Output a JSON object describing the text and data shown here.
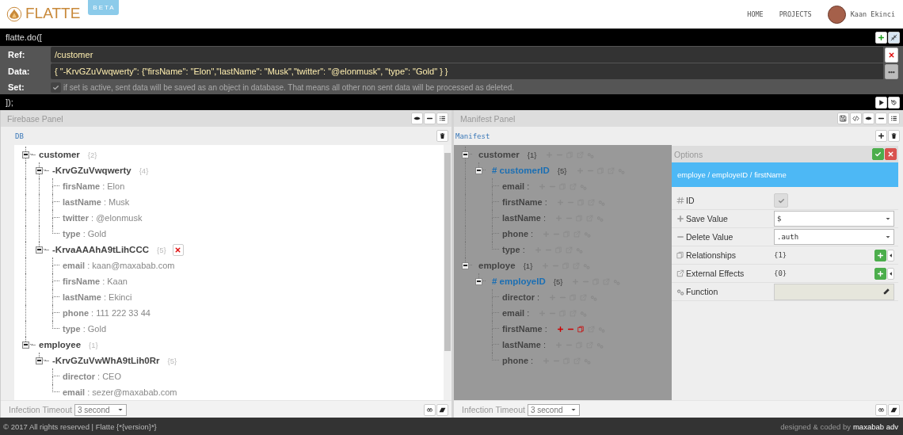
{
  "header": {
    "logo": "FLATTE",
    "badge": "BETA",
    "nav": [
      {
        "label": "HOME"
      },
      {
        "label": "PROJECTS"
      }
    ],
    "user": "Kaan Ekinci"
  },
  "command": {
    "open": "flatte.do([",
    "close": "]);",
    "rows": [
      {
        "kind": "text",
        "label": "Ref:",
        "value": "/customer"
      },
      {
        "kind": "text",
        "label": "Data:",
        "value": "{ \"-KrvGZuVwqwerty\": {\"firsName\": \"Elon\",\"lastName\": \"Musk\",\"twitter\": \"@elonmusk\",  \"type\": \"Gold\" } }"
      },
      {
        "kind": "checkbox",
        "label": "Set:",
        "checked": true,
        "hint": "if set is active, sent data will be saved as an object in database. That means all other non sent data will be processed as deleted."
      }
    ]
  },
  "firebase_panel": {
    "title": "Firebase Panel",
    "root": "DB",
    "timeout_label": "Infection Timeout",
    "timeout": "3 second",
    "tree": [
      {
        "key": "customer",
        "count": "{2}",
        "expanded": true,
        "delete_button": false,
        "children": [
          {
            "key": "-KrvGZuVwqwerty",
            "count": "{4}",
            "expanded": true,
            "delete_button": false,
            "children": [
              {
                "label": "**firsName** : Elon"
              },
              {
                "label": "**lastName** : Musk"
              },
              {
                "label": "**twitter** : @elonmusk"
              },
              {
                "label": "**type** : Gold"
              }
            ]
          },
          {
            "key": "-KrvaAAAhA9tLihCCC",
            "count": "{5}",
            "expanded": true,
            "delete_button": true,
            "children": [
              {
                "label": "**email** : kaan@maxabab.com"
              },
              {
                "label": "**firsName** : Kaan"
              },
              {
                "label": "**lastName** : Ekinci"
              },
              {
                "label": "**phone** : 111 222 33 44"
              },
              {
                "label": "**type** : Gold"
              }
            ]
          }
        ]
      },
      {
        "key": "employee",
        "count": "{1}",
        "expanded": true,
        "delete_button": false,
        "children": [
          {
            "key": "-KrvGZuVwWhA9tLih0Rr",
            "count": "{5}",
            "expanded": true,
            "delete_button": false,
            "children": [
              {
                "label": "**director** : CEO"
              },
              {
                "label": "**email** : sezer@maxabab.com"
              }
            ]
          }
        ]
      }
    ]
  },
  "manifest_panel": {
    "title": "Manifest Panel",
    "root": "Manifest",
    "timeout_label": "Infection Timeout",
    "timeout": "3 second",
    "tree": [
      {
        "key": "customer",
        "count": "{1}",
        "id": false,
        "expanded": true,
        "children": [
          {
            "key": "# customerID",
            "count": "{5}",
            "id": true,
            "expanded": true,
            "children": [
              {
                "label": "**email** :",
                "active": false
              },
              {
                "label": "**firstName** :",
                "active": false
              },
              {
                "label": "**lastName** :",
                "active": false
              },
              {
                "label": "**phone** :",
                "active": false
              },
              {
                "label": "**type** :",
                "active": false
              }
            ]
          }
        ]
      },
      {
        "key": "employe",
        "count": "{1}",
        "id": false,
        "expanded": true,
        "children": [
          {
            "key": "# employeID",
            "count": "{5}",
            "id": true,
            "expanded": true,
            "children": [
              {
                "label": "**director** :",
                "active": false
              },
              {
                "label": "**email** :",
                "active": false
              },
              {
                "label": "**firstName** :",
                "active": true
              },
              {
                "label": "**lastName** :",
                "active": false
              },
              {
                "label": "**phone** :",
                "active": false
              }
            ]
          }
        ]
      }
    ],
    "options": {
      "title": "Options",
      "path": "employe / employeID / firstName",
      "rows": [
        {
          "kind": "checkbox",
          "label": "ID",
          "checked": true
        },
        {
          "kind": "select",
          "label": "Save Value",
          "value": "$"
        },
        {
          "kind": "select",
          "label": "Delete Value",
          "value": ".auth"
        },
        {
          "kind": "count",
          "label": "Relationships",
          "value": "{1}"
        },
        {
          "kind": "count",
          "label": "External Effects",
          "value": "{0}"
        },
        {
          "kind": "function",
          "label": "Function"
        }
      ]
    }
  },
  "footer": {
    "left": "© 2017 All rights reserved | Flatte {*{version}*}",
    "credit": "designed & coded by",
    "author": "maxabab adv"
  }
}
